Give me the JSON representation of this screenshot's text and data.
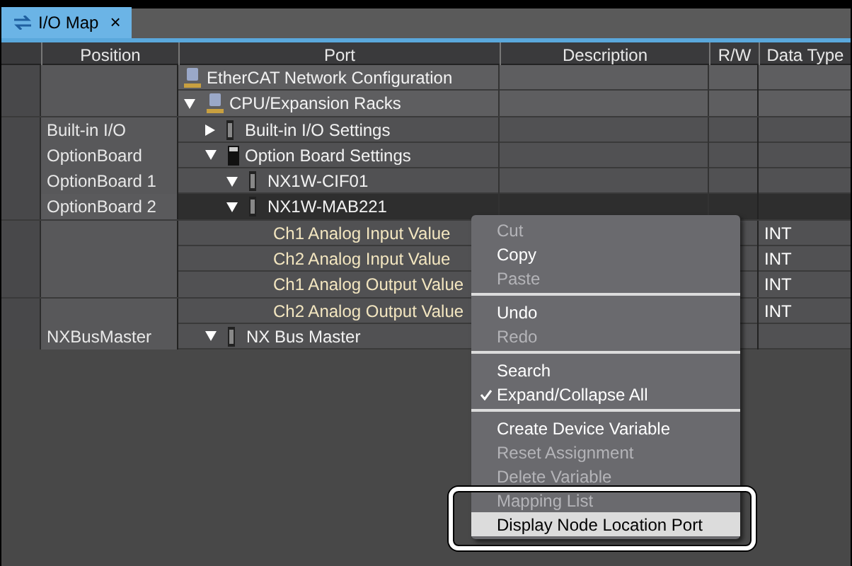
{
  "tab": {
    "title": "I/O Map",
    "close": "×",
    "selected": true
  },
  "columns": [
    "Position",
    "Port",
    "Description",
    "R/W",
    "Data Type"
  ],
  "tree": [
    {
      "kind": "network",
      "port": "EtherCAT Network Configuration",
      "selected": false
    },
    {
      "kind": "network",
      "port": "CPU/Expansion Racks",
      "expanded": true,
      "selected": false,
      "children": [
        {
          "kind": "unit",
          "position": "Built-in I/O",
          "port": "Built-in I/O Settings",
          "expanded": false,
          "selected": false
        },
        {
          "kind": "board",
          "position": "OptionBoard",
          "port": "Option Board Settings",
          "expanded": true,
          "selected": false,
          "children": [
            {
              "kind": "unit",
              "position": "OptionBoard 1",
              "port": "NX1W-CIF01",
              "expanded": true,
              "selected": false
            },
            {
              "kind": "unit",
              "position": "OptionBoard 2",
              "port": "NX1W-MAB221",
              "expanded": true,
              "selected": true,
              "children": [
                {
                  "kind": "variable",
                  "port": "Ch1 Analog Input Value",
                  "data_type": "INT",
                  "selected": false
                },
                {
                  "kind": "variable",
                  "port": "Ch2 Analog Input Value",
                  "data_type": "INT",
                  "selected": false
                },
                {
                  "kind": "variable",
                  "port": "Ch1 Analog Output Value",
                  "data_type": "INT",
                  "selected": false
                },
                {
                  "kind": "variable",
                  "port": "Ch2 Analog Output Value",
                  "data_type": "INT",
                  "selected": false
                }
              ]
            }
          ]
        },
        {
          "kind": "unit",
          "position": "NXBusMaster",
          "port": "NX Bus Master",
          "expanded": true,
          "selected": false
        }
      ]
    }
  ],
  "context_menu": [
    [
      {
        "label": "Cut",
        "disabled": true,
        "checked": false,
        "selected": false
      },
      {
        "label": "Copy",
        "disabled": false,
        "checked": false,
        "selected": false
      },
      {
        "label": "Paste",
        "disabled": true,
        "checked": false,
        "selected": false
      }
    ],
    [
      {
        "label": "Undo",
        "disabled": false,
        "checked": false,
        "selected": false
      },
      {
        "label": "Redo",
        "disabled": true,
        "checked": false,
        "selected": false
      }
    ],
    [
      {
        "label": "Search",
        "disabled": false,
        "checked": false,
        "selected": false
      },
      {
        "label": "Expand/Collapse All",
        "disabled": false,
        "checked": true,
        "selected": false
      }
    ],
    [
      {
        "label": "Create Device Variable",
        "disabled": false,
        "checked": false,
        "selected": false
      },
      {
        "label": "Reset Assignment",
        "disabled": true,
        "checked": false,
        "selected": false
      },
      {
        "label": "Delete Variable",
        "disabled": true,
        "checked": false,
        "selected": false
      },
      {
        "label": "Mapping List",
        "disabled": true,
        "checked": false,
        "selected": false
      },
      {
        "label": "Display Node Location Port",
        "disabled": false,
        "checked": false,
        "selected": true
      }
    ]
  ]
}
